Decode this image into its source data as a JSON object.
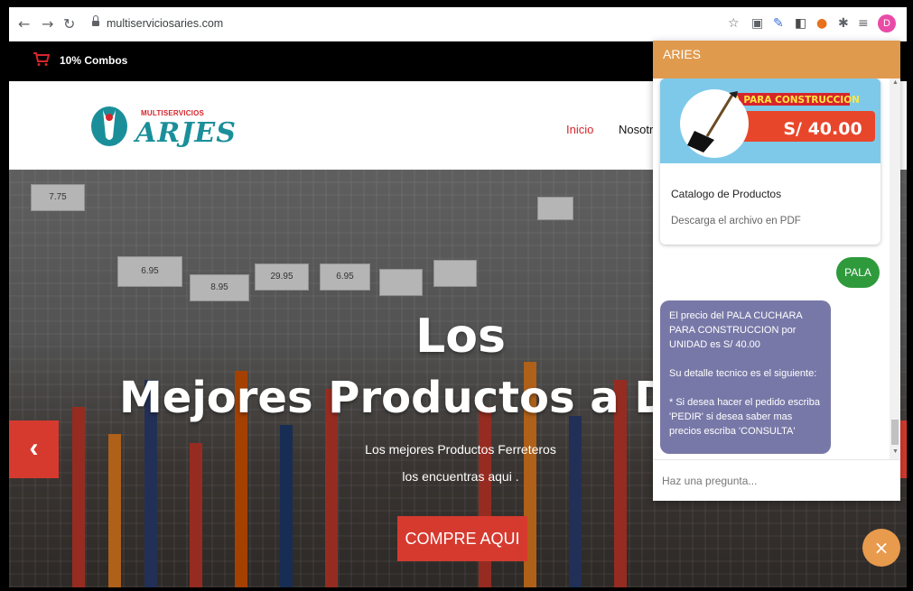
{
  "browser": {
    "url": "multiserviciosaries.com",
    "profile_initial": "D"
  },
  "site": {
    "topbar_text": "10% Combos",
    "logo_small": "MULTISERVICIOS",
    "logo_big": "ARJES",
    "menu": [
      "Inicio",
      "Nosotro"
    ],
    "hero_line1": "Los",
    "hero_line2": "Mejores Productos a DE",
    "hero_sub1": "Los mejores Productos Ferreteros",
    "hero_sub2": "los encuentras aqui .",
    "cta_label": "COMPRE AQUI",
    "tag_prices": [
      "7.75",
      "6.95",
      "8.95",
      "29.95",
      "6.95"
    ],
    "prev_icon": "‹"
  },
  "chat": {
    "title": "ARIES",
    "card": {
      "image_banner": "PALA PARA CONSTRUCCION",
      "image_price": "S/ 40.00",
      "title": "Catalogo de Productos",
      "description": "Descarga el archivo en PDF"
    },
    "user_message": "PALA",
    "bot_message": {
      "line1": "El precio del PALA CUCHARA PARA CONSTRUCCION por UNIDAD es S/ 40.00",
      "line2": "Su detalle tecnico es el siguiente:",
      "line3": "* Si desea hacer el pedido escriba 'PEDIR' si desea saber mas precios escriba 'CONSULTA'"
    },
    "input_placeholder": "Haz una pregunta...",
    "close_icon": "×"
  }
}
